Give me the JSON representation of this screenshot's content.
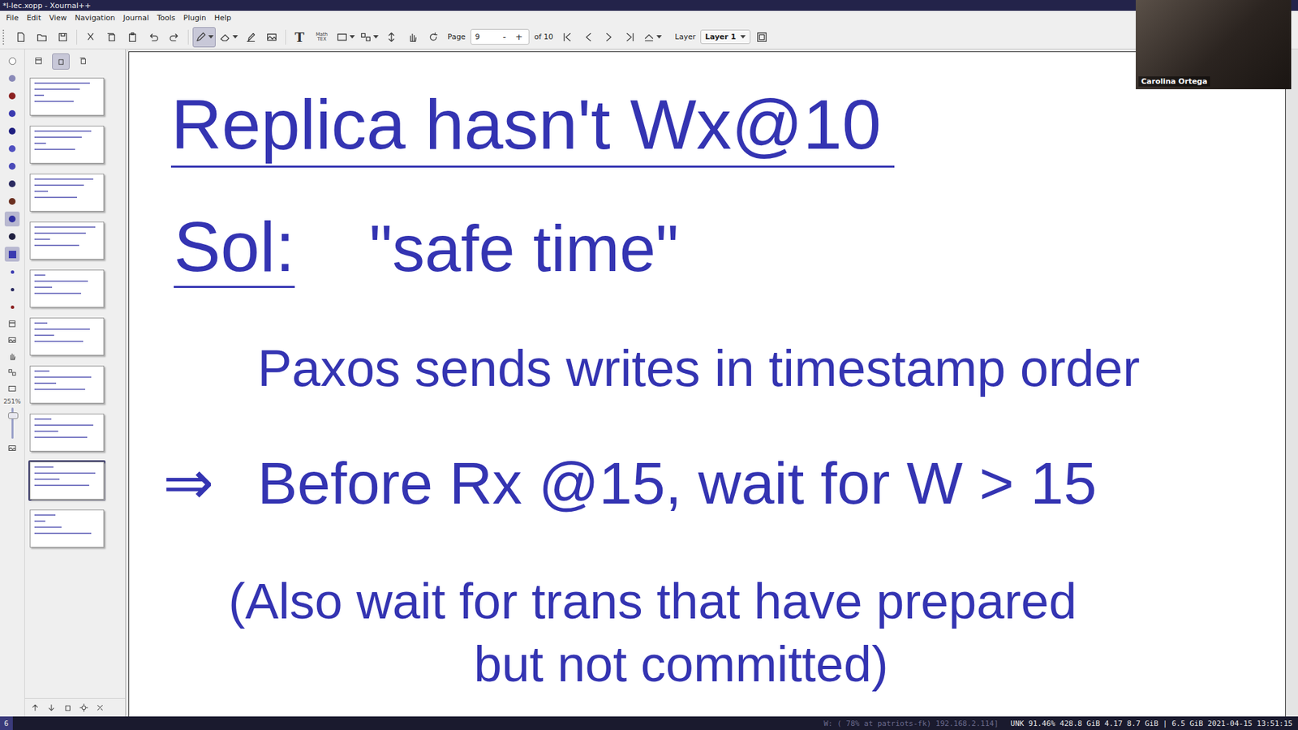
{
  "window": {
    "title": "*l-lec.xopp - Xournal++"
  },
  "menu": [
    "File",
    "Edit",
    "View",
    "Navigation",
    "Journal",
    "Tools",
    "Plugin",
    "Help"
  ],
  "toolbar": {
    "selected_tool": "pen",
    "text_tool": "T",
    "tex_tool": "Math TEX",
    "page_label": "Page",
    "page": "9",
    "minus": "-",
    "plus": "+",
    "page_of": "of 10",
    "layer_label": "Layer",
    "layer": "Layer 1"
  },
  "palette": [
    {
      "kind": "ring",
      "color": "#ffffff",
      "selected": false
    },
    {
      "kind": "circle",
      "color": "#8a8ab8",
      "selected": false
    },
    {
      "kind": "circle",
      "color": "#8b2020",
      "selected": false
    },
    {
      "kind": "circle",
      "color": "#3a3ab0",
      "selected": false
    },
    {
      "kind": "circle",
      "color": "#1f1f80",
      "selected": false
    },
    {
      "kind": "circle",
      "color": "#5050c0",
      "selected": false
    },
    {
      "kind": "circle",
      "color": "#4a4ab8",
      "selected": false
    },
    {
      "kind": "circle",
      "color": "#2a2a60",
      "selected": false
    },
    {
      "kind": "circle",
      "color": "#6b3020",
      "selected": false
    },
    {
      "kind": "circle",
      "color": "#3030a0",
      "selected": true
    },
    {
      "kind": "circle",
      "color": "#202040",
      "selected": false
    },
    {
      "kind": "square",
      "color": "#3a3ab0",
      "selected": true
    },
    {
      "kind": "dot",
      "color": "#3a3ab0",
      "selected": false
    },
    {
      "kind": "dot",
      "color": "#2a2a60",
      "selected": false
    },
    {
      "kind": "dot",
      "color": "#8b2020",
      "selected": false
    }
  ],
  "zoom": "251%",
  "zoom_slider": {
    "level": 0.85
  },
  "sidebar_views": [
    {
      "selected": false
    },
    {
      "selected": true
    },
    {
      "selected": false
    }
  ],
  "thumbnails": [
    {
      "selected": false
    },
    {
      "selected": false
    },
    {
      "selected": false
    },
    {
      "selected": false
    },
    {
      "selected": false
    },
    {
      "selected": false
    },
    {
      "selected": false
    },
    {
      "selected": false
    },
    {
      "selected": true
    },
    {
      "selected": false
    }
  ],
  "webcam": {
    "name": "Carolina Ortega"
  },
  "note": {
    "heading": {
      "text": "Replica hasn't Wx@10",
      "underlined": true
    },
    "solution": {
      "label": "Sol:",
      "label_underlined": true,
      "text": "\"safe time\""
    },
    "lines": [
      {
        "kind": "indent",
        "marker": "",
        "text": "Paxos sends writes in timestamp order"
      },
      {
        "kind": "arrow",
        "marker": "⇒",
        "text": "Before Rx @15, wait for W > 15"
      },
      {
        "kind": "paren",
        "marker": "",
        "text": "(Also wait for trans that have prepared"
      },
      {
        "kind": "center",
        "marker": "",
        "text": "but not committed)"
      }
    ]
  },
  "status_bar": {
    "workspace": "6",
    "network": "W: ( 78% at patriots-fk) 192.168.2.114]",
    "info": "UNK 91.46% 428.8 GiB 4.17 8.7 GiB | 6.5 GiB 2021-04-15 13:51:15"
  }
}
